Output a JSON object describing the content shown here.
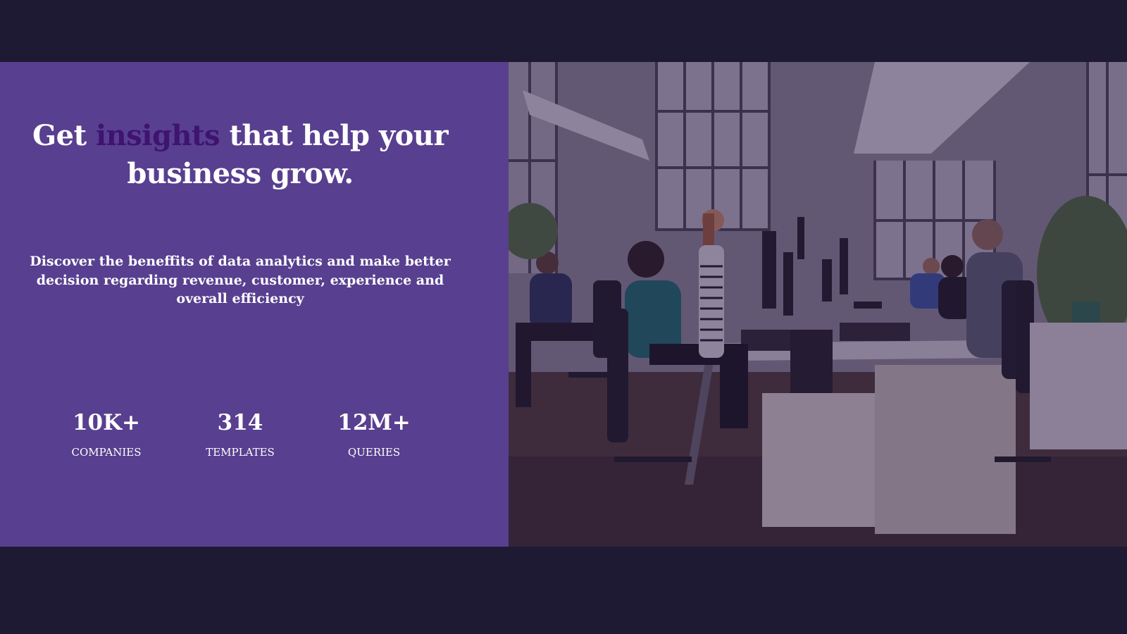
{
  "hero": {
    "headline": {
      "before": "Get ",
      "accent": "insights",
      "after": " that help your business grow."
    },
    "subtext": "Discover the beneffits of data analytics and make better decision regarding revenue, customer, experience and overall efficiency",
    "stats": [
      {
        "value": "10K+",
        "label": "COMPANIES"
      },
      {
        "value": "314",
        "label": "TEMPLATES"
      },
      {
        "value": "12M+",
        "label": "QUERIES"
      }
    ]
  },
  "colors": {
    "page_background": "#1e1a33",
    "panel_background": "#583f8f",
    "headline_accent": "#3e1470",
    "text": "#ffffff"
  }
}
